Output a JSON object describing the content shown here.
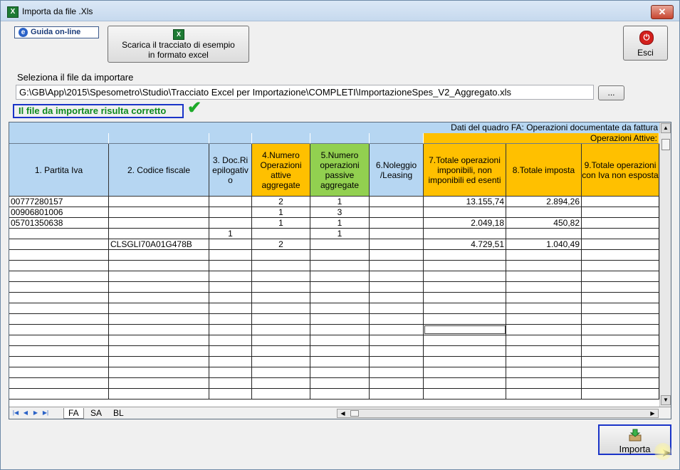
{
  "window": {
    "title": "Importa da file .Xls",
    "close_glyph": "✕"
  },
  "toolbar": {
    "guida_label": "Guida on-line",
    "scarica_line1": "Scarica il tracciato di esempio",
    "scarica_line2": "in formato excel",
    "esci_label": "Esci"
  },
  "file": {
    "select_label": "Seleziona il file da importare",
    "path": "G:\\GB\\App\\2015\\Spesometro\\Studio\\Tracciato Excel per Importazione\\COMPLETI\\ImportazioneSpes_V2_Aggregato.xls",
    "browse_label": "...",
    "status": "Il file da importare risulta corretto",
    "check_glyph": "✔"
  },
  "grid": {
    "section_title": "Dati del quadro FA: Operazioni documentate da fattura",
    "subgroup_title": "Operazioni Attive:",
    "columns": [
      {
        "label": "1. Partita Iva"
      },
      {
        "label": "2. Codice fiscale"
      },
      {
        "label": "3. Doc.Riepilogativo"
      },
      {
        "label": "4.Numero Operazioni attive aggregate"
      },
      {
        "label": "5.Numero operazioni passive aggregate"
      },
      {
        "label": "6.Noleggio /Leasing"
      },
      {
        "label": "7.Totale operazioni imponibili, non imponibili ed esenti"
      },
      {
        "label": "8.Totale imposta"
      },
      {
        "label": "9.Totale operazioni con Iva non esposta"
      }
    ],
    "rows": [
      [
        "00777280157",
        "",
        "",
        "2",
        "1",
        "",
        "13.155,74",
        "2.894,26",
        ""
      ],
      [
        "00906801006",
        "",
        "",
        "1",
        "3",
        "",
        "",
        "",
        ""
      ],
      [
        "05701350638",
        "",
        "",
        "1",
        "1",
        "",
        "2.049,18",
        "450,82",
        ""
      ],
      [
        "",
        "",
        "1",
        "",
        "1",
        "",
        "",
        "",
        ""
      ],
      [
        "",
        "CLSGLI70A01G478B",
        "",
        "2",
        "",
        "",
        "4.729,51",
        "1.040,49",
        ""
      ]
    ],
    "tabs": [
      "FA",
      "SA",
      "BL"
    ],
    "active_tab": "FA"
  },
  "actions": {
    "importa_label": "Importa"
  },
  "colors": {
    "header_blue": "#b6d6f2",
    "header_orange": "#ffc000",
    "header_green": "#92d050",
    "status_green": "#0e8a1e",
    "focus_border": "#1a34c8"
  }
}
